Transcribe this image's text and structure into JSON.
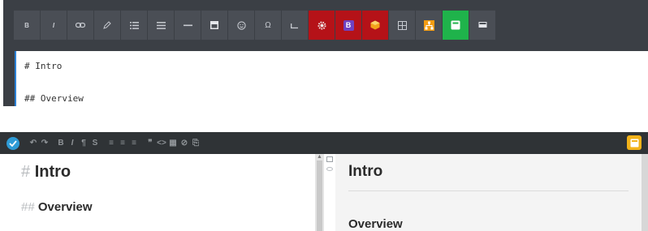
{
  "editor1": {
    "toolbar": [
      {
        "name": "bold-button",
        "label": "B",
        "style": "dark"
      },
      {
        "name": "italic-button",
        "label": "I",
        "style": "dark"
      },
      {
        "name": "link-button",
        "icon": "link-icon",
        "style": "dark"
      },
      {
        "name": "attach-button",
        "icon": "pencil-icon",
        "style": "dark"
      },
      {
        "name": "unordered-list-button",
        "icon": "list-icon",
        "style": "dark"
      },
      {
        "name": "align-button",
        "icon": "align-icon",
        "style": "dark"
      },
      {
        "name": "horizontal-rule-button",
        "icon": "minus-icon",
        "style": "dark"
      },
      {
        "name": "image-button",
        "icon": "image-icon",
        "style": "dark"
      },
      {
        "name": "emoji-button",
        "icon": "smiley-icon",
        "style": "dark"
      },
      {
        "name": "special-char-button",
        "icon": "omega-icon",
        "style": "dark"
      },
      {
        "name": "code-button",
        "icon": "code-block-icon",
        "style": "dark"
      },
      {
        "name": "settings-button",
        "icon": "gear-icon",
        "style": "red"
      },
      {
        "name": "bootstrap-button",
        "label": "B",
        "style": "red"
      },
      {
        "name": "package-button",
        "icon": "box-icon",
        "style": "red"
      },
      {
        "name": "table-button",
        "icon": "grid-icon",
        "style": "dark"
      },
      {
        "name": "sitemap-button",
        "icon": "sitemap-icon",
        "style": "dark"
      },
      {
        "name": "preview-button",
        "icon": "note-icon",
        "style": "green"
      },
      {
        "name": "monitor-button",
        "icon": "monitor-icon",
        "style": "dark"
      }
    ],
    "content_lines": [
      "# Intro",
      "## Overview"
    ]
  },
  "editor2": {
    "toolbar_items": [
      "↶",
      "↷",
      "B",
      "I",
      "¶",
      "S",
      "≡",
      "≡",
      "≡",
      "❞",
      "<>",
      "▦",
      "⊘",
      "⎘"
    ],
    "left_pane": {
      "h1_marker": "#",
      "h1_text": "Intro",
      "h2_marker": "##",
      "h2_text": "Overview"
    },
    "right_pane": {
      "h1_text": "Intro",
      "h2_text": "Overview"
    },
    "colors": {
      "accent": "#2e9bd6",
      "fullscreen": "#f2b21a",
      "toolbar_red": "#b51218",
      "toolbar_green": "#1fb34b"
    }
  }
}
